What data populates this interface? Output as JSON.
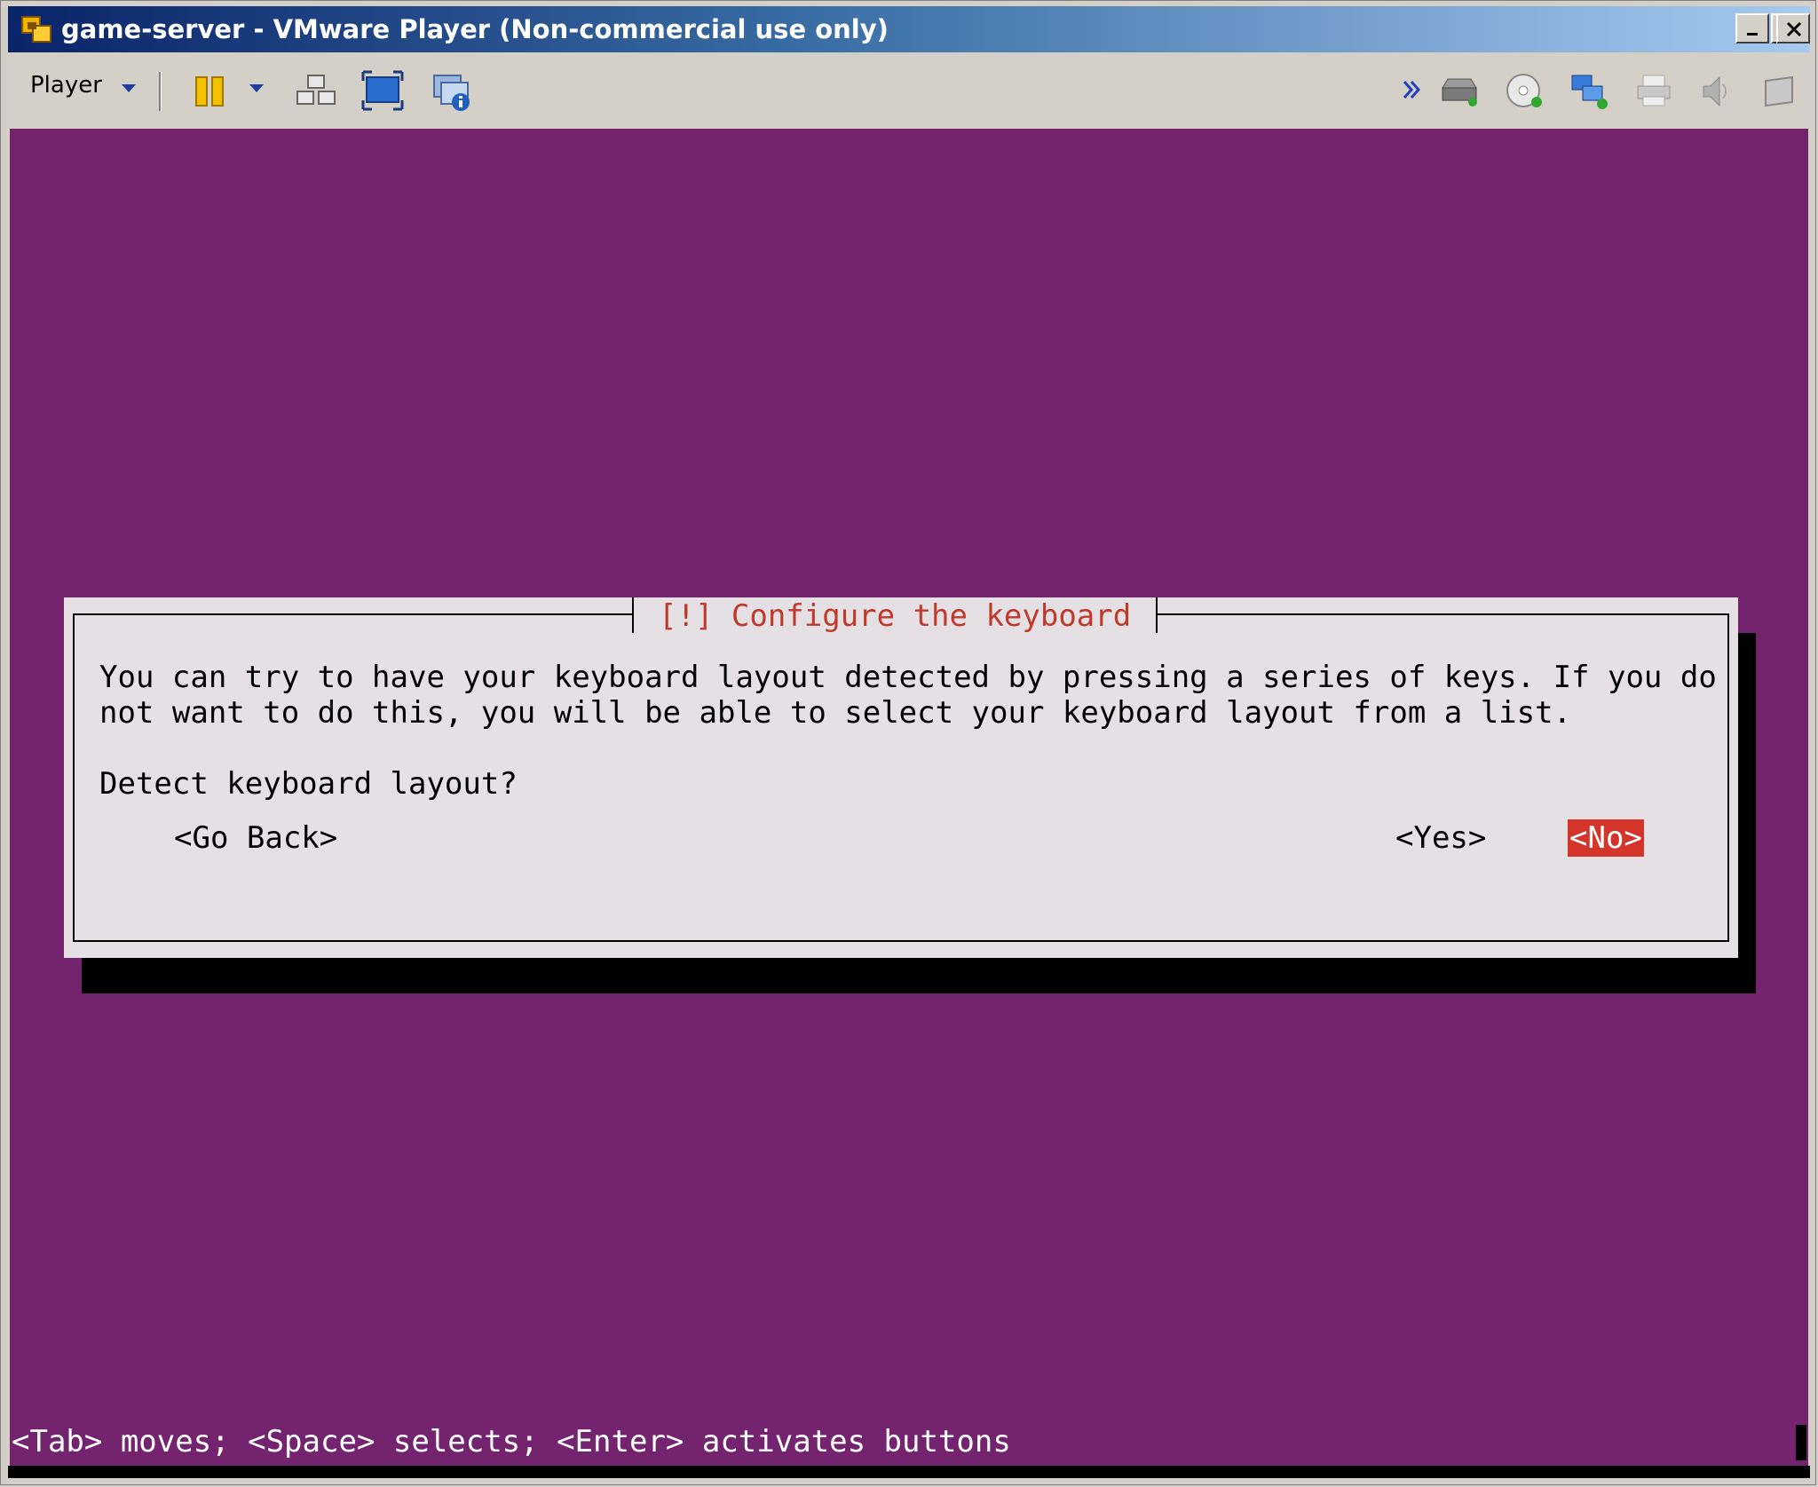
{
  "window": {
    "title": "game-server - VMware Player (Non-commercial use only)"
  },
  "toolbar": {
    "player_menu_label": "Player"
  },
  "dialog": {
    "title": "[!] Configure the keyboard",
    "body_line1": "You can try to have your keyboard layout detected by pressing a series of keys. If you do",
    "body_line2": "not want to do this, you will be able to select your keyboard layout from a list.",
    "question": "Detect keyboard layout?",
    "buttons": {
      "go_back": "<Go Back>",
      "yes": "<Yes>",
      "no": "<No>"
    },
    "selected_button": "no"
  },
  "status_bar": {
    "help_text": "<Tab> moves; <Space> selects; <Enter> activates buttons"
  },
  "colors": {
    "console_background": "#74236f",
    "dialog_background": "#e4e0e4",
    "dialog_title": "#c0392b",
    "selected_button": "#d4342a"
  }
}
